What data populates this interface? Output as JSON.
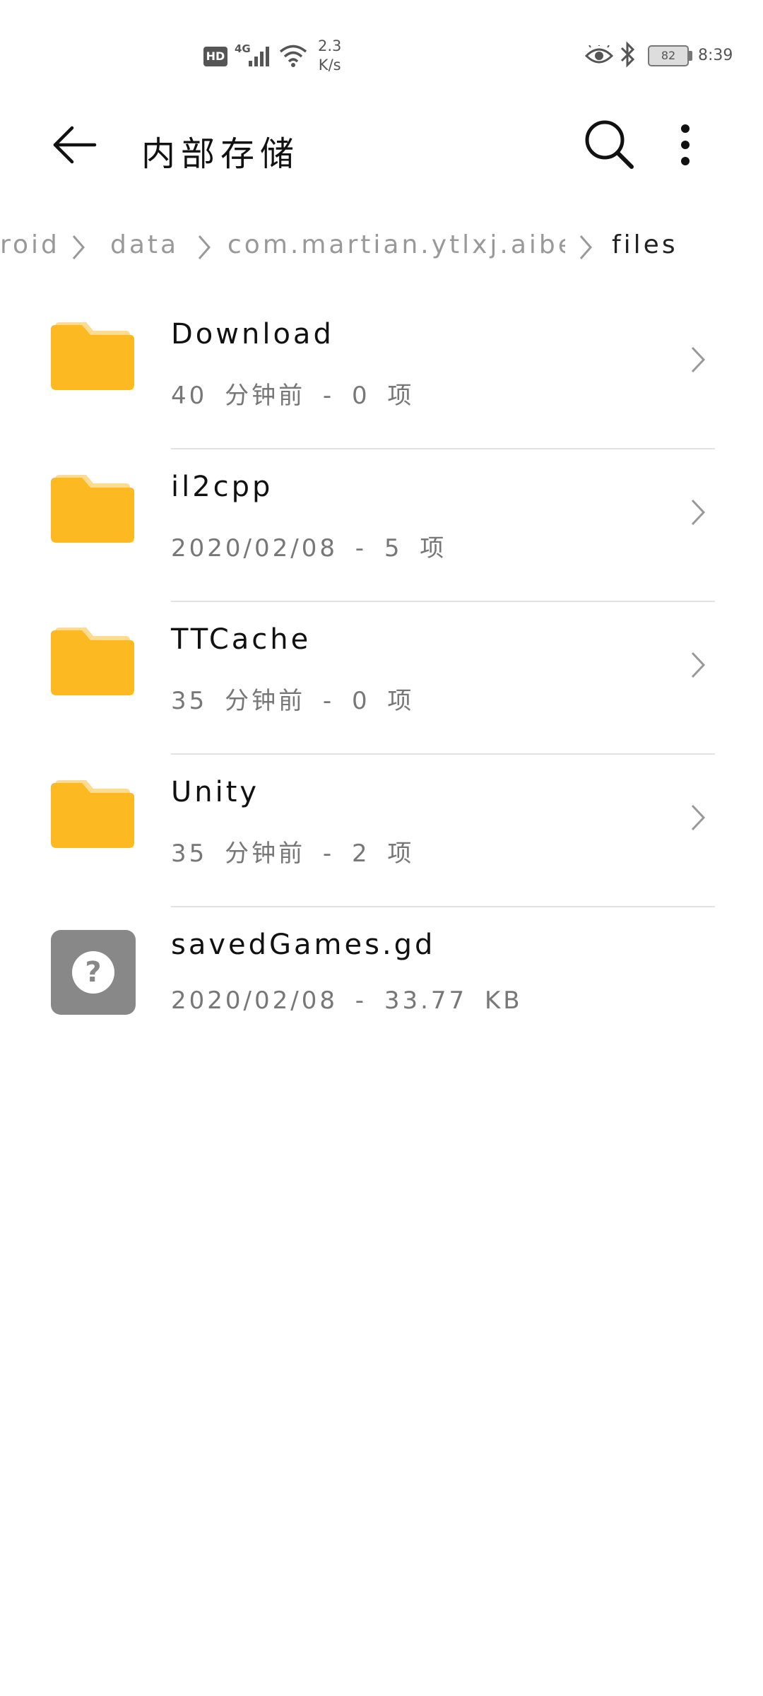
{
  "status_bar": {
    "hd": "HD",
    "network_type": "4G",
    "net_speed_value": "2.3",
    "net_speed_unit": "K/s",
    "battery_level": "82",
    "time": "8:39"
  },
  "toolbar": {
    "title": "内部存储"
  },
  "breadcrumb": {
    "items": [
      "roid",
      "data",
      "com.martian.ytlxj.aibei",
      "files"
    ]
  },
  "files": [
    {
      "name": "Download",
      "meta": "40 分钟前 - 0 项",
      "type": "folder"
    },
    {
      "name": "il2cpp",
      "meta": "2020/02/08 - 5 项",
      "type": "folder"
    },
    {
      "name": "TTCache",
      "meta": "35 分钟前 - 0 项",
      "type": "folder"
    },
    {
      "name": "Unity",
      "meta": "35 分钟前 - 2 项",
      "type": "folder"
    },
    {
      "name": "savedGames.gd",
      "meta": "2020/02/08 - 33.77 KB",
      "type": "file"
    }
  ],
  "colors": {
    "folder": "#FDB922",
    "folder_tab": "#FDDC8F",
    "unknown_file": "#888888"
  }
}
